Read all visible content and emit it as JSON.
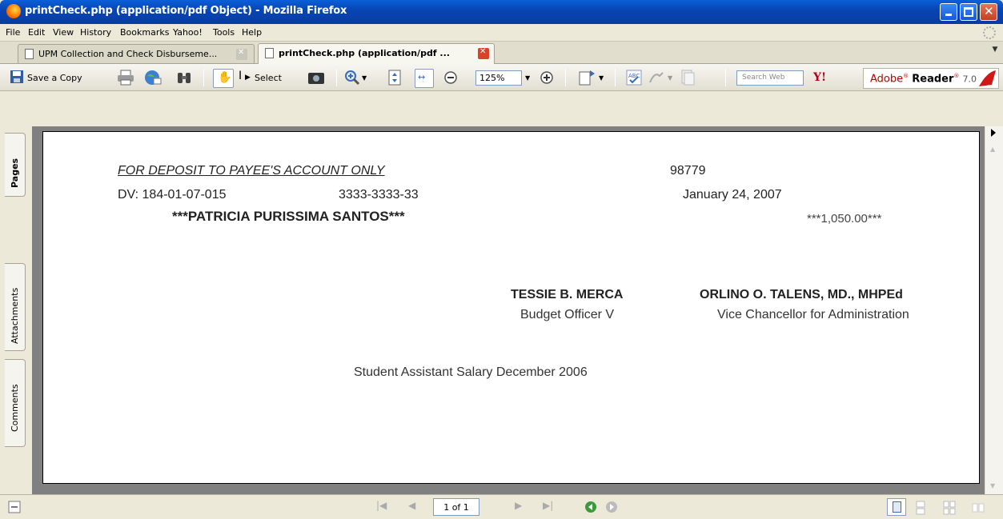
{
  "window": {
    "title": "printCheck.php (application/pdf Object) - Mozilla Firefox",
    "minimize": "_",
    "maximize": "□",
    "close": "✕"
  },
  "menu": [
    "File",
    "Edit",
    "View",
    "History",
    "Bookmarks",
    "Yahoo!",
    "Tools",
    "Help"
  ],
  "tabs": [
    {
      "label": "UPM Collection and Check Disburseme...",
      "active": false
    },
    {
      "label": "printCheck.php (application/pdf ...",
      "active": true
    }
  ],
  "toolbar": {
    "save_label": "Save a Copy",
    "select_label": "Select",
    "zoom_value": "125%",
    "search_placeholder": "Search Web",
    "yahoo_label": "Y!",
    "brand": "Adobe",
    "brand_product": "Reader",
    "brand_version": "7.0"
  },
  "sidetabs": [
    "Pages",
    "Attachments",
    "Comments"
  ],
  "check": {
    "deposit_line": "FOR DEPOSIT TO PAYEE'S ACCOUNT ONLY",
    "check_number": "98779",
    "dv": "DV: 184-01-07-015",
    "account": "3333-3333-33",
    "date": "January 24, 2007",
    "payee": "***PATRICIA PURISSIMA SANTOS***",
    "amount": "***1,050.00***",
    "signatory1_name": "TESSIE B. MERCA",
    "signatory1_title": "Budget Officer V",
    "signatory2_name": "ORLINO O. TALENS, MD., MHPEd",
    "signatory2_title": "Vice Chancellor for Administration",
    "memo": "Student Assistant Salary December 2006"
  },
  "status": {
    "page_indicator": "1 of 1"
  }
}
